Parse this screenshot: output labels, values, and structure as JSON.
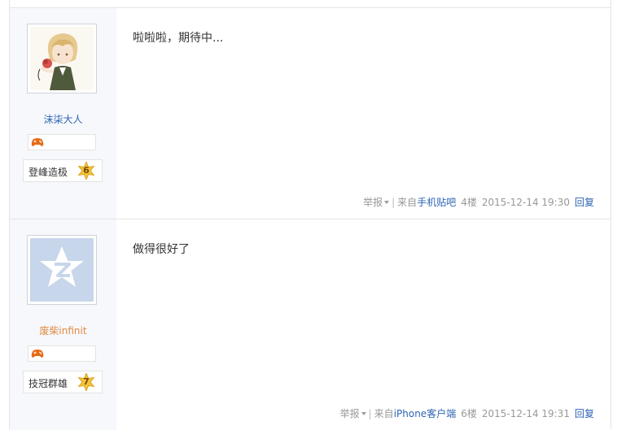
{
  "posts": [
    {
      "username": "沫柒大人",
      "level_title": "登峰造极",
      "level": "6",
      "content": "啦啦啦，期待中...",
      "report_label": "举报",
      "from_prefix": "来自",
      "source": "手机贴吧",
      "floor": "4楼",
      "time": "2015-12-14 19:30",
      "reply_label": "回复",
      "avatar_icon": "anime-boy-avatar-icon",
      "badge_icon": "game-controller-icon"
    },
    {
      "username": "废柴infinit",
      "level_title": "技冠群雄",
      "level": "7",
      "content": "做得很好了",
      "report_label": "举报",
      "from_prefix": "来自",
      "source": "iPhone客户端",
      "floor": "6楼",
      "time": "2015-12-14 19:31",
      "reply_label": "回复",
      "avatar_icon": "default-qq-avatar-icon",
      "badge_icon": "game-controller-icon"
    }
  ],
  "colors": {
    "link": "#2d64b3",
    "username_orange": "#e08a3c",
    "meta_gray": "#999999",
    "sidebar_bg": "#f6f8fc"
  }
}
